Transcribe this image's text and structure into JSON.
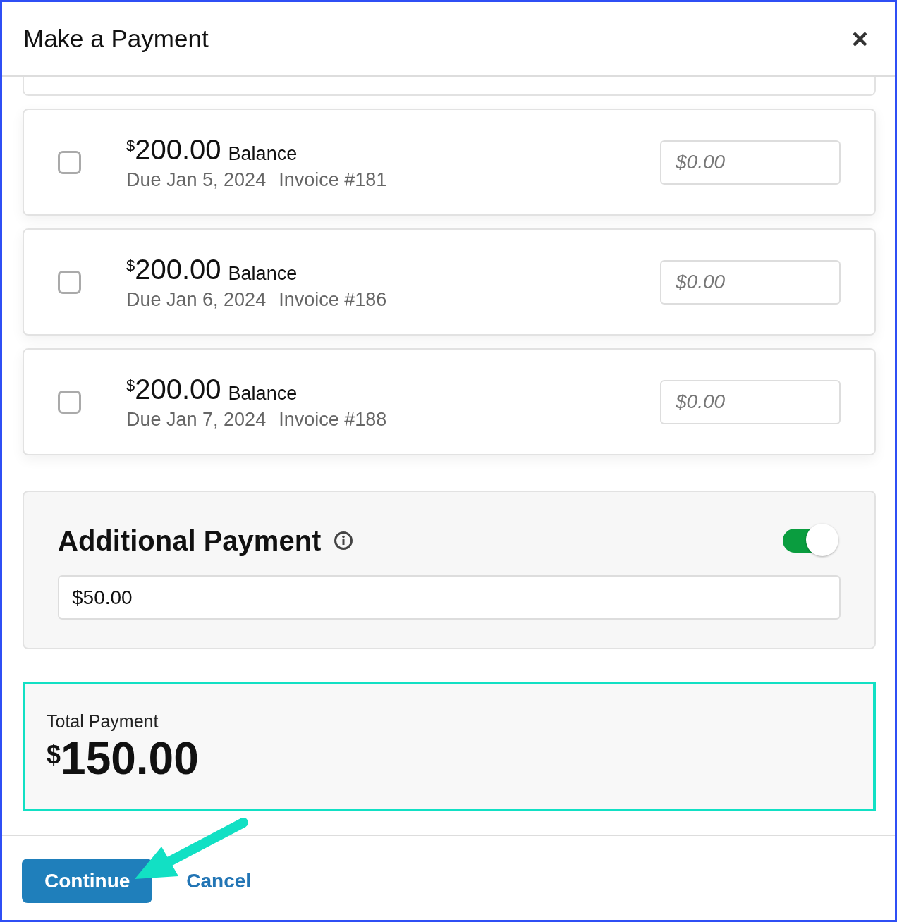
{
  "dialog": {
    "title": "Make a Payment",
    "close": "×"
  },
  "invoices": [
    {
      "currency": "$",
      "amount": "200.00",
      "label": "Balance",
      "due": "Due Jan 5, 2024",
      "invoice": "Invoice #181",
      "checked": false,
      "placeholder": "$0.00"
    },
    {
      "currency": "$",
      "amount": "200.00",
      "label": "Balance",
      "due": "Due Jan 6, 2024",
      "invoice": "Invoice #186",
      "checked": false,
      "placeholder": "$0.00"
    },
    {
      "currency": "$",
      "amount": "200.00",
      "label": "Balance",
      "due": "Due Jan 7, 2024",
      "invoice": "Invoice #188",
      "checked": false,
      "placeholder": "$0.00"
    }
  ],
  "additional": {
    "title": "Additional Payment",
    "on": true,
    "value": "$50.00"
  },
  "total": {
    "label": "Total Payment",
    "currency": "$",
    "amount": "150.00"
  },
  "buttons": [
    {
      "kind": "primary",
      "label": "Continue"
    },
    {
      "kind": "link",
      "label": "Cancel"
    }
  ]
}
